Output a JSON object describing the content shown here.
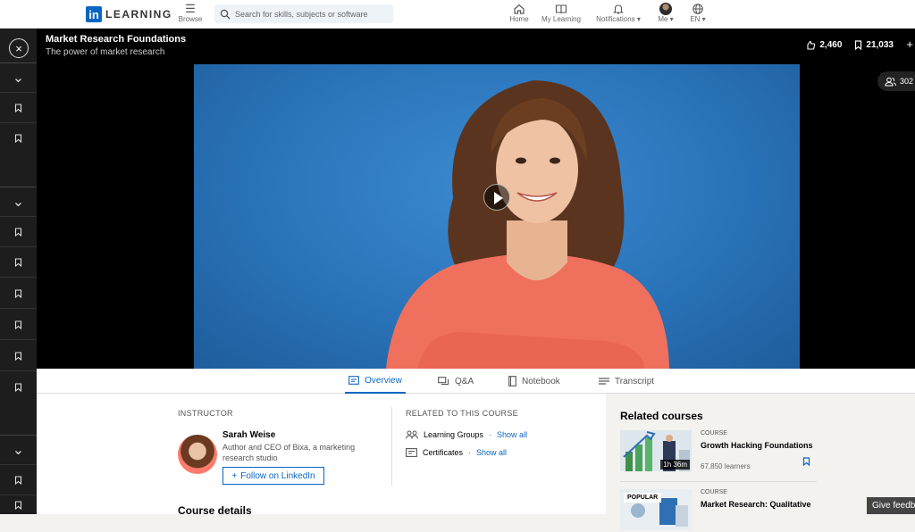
{
  "topnav": {
    "logo_in": "in",
    "logo_word": "LEARNING",
    "browse_label": "Browse",
    "search_placeholder": "Search for skills, subjects or software",
    "home_label": "Home",
    "my_learning_label": "My Learning",
    "notifications_label": "Notifications",
    "me_label": "Me",
    "lang_label": "EN"
  },
  "video": {
    "title": "Market Research Foundations",
    "subtitle": "The power of market research",
    "likes": "2,460",
    "saves": "21,033",
    "viewers": "302"
  },
  "tabs": [
    {
      "label": "Overview",
      "icon": "overview-icon"
    },
    {
      "label": "Q&A",
      "icon": "qa-icon"
    },
    {
      "label": "Notebook",
      "icon": "notebook-icon"
    },
    {
      "label": "Transcript",
      "icon": "transcript-icon"
    }
  ],
  "overview": {
    "instructor_heading": "INSTRUCTOR",
    "instructor_name": "Sarah Weise",
    "instructor_role": "Author and CEO of Bixa, a marketing research studio",
    "follow_label": "Follow on LinkedIn",
    "related_heading": "RELATED TO THIS COURSE",
    "related": [
      {
        "label": "Learning Groups",
        "link": "Show all",
        "sep": "·"
      },
      {
        "label": "Certificates",
        "link": "Show all",
        "sep": "·"
      }
    ],
    "details_heading": "Course details"
  },
  "related_courses": {
    "heading": "Related courses",
    "items": [
      {
        "kind": "COURSE",
        "title": "Growth Hacking Foundations",
        "duration": "1h 36m",
        "learners": "67,850 learners"
      },
      {
        "kind": "COURSE",
        "title": "Market Research: Qualitative",
        "badge": "POPULAR"
      }
    ]
  },
  "feedback_label": "Give feedback",
  "colors": {
    "accent": "#0a66c2",
    "rail": "#1d1d1d",
    "stage_blue": "#2a73b9"
  }
}
